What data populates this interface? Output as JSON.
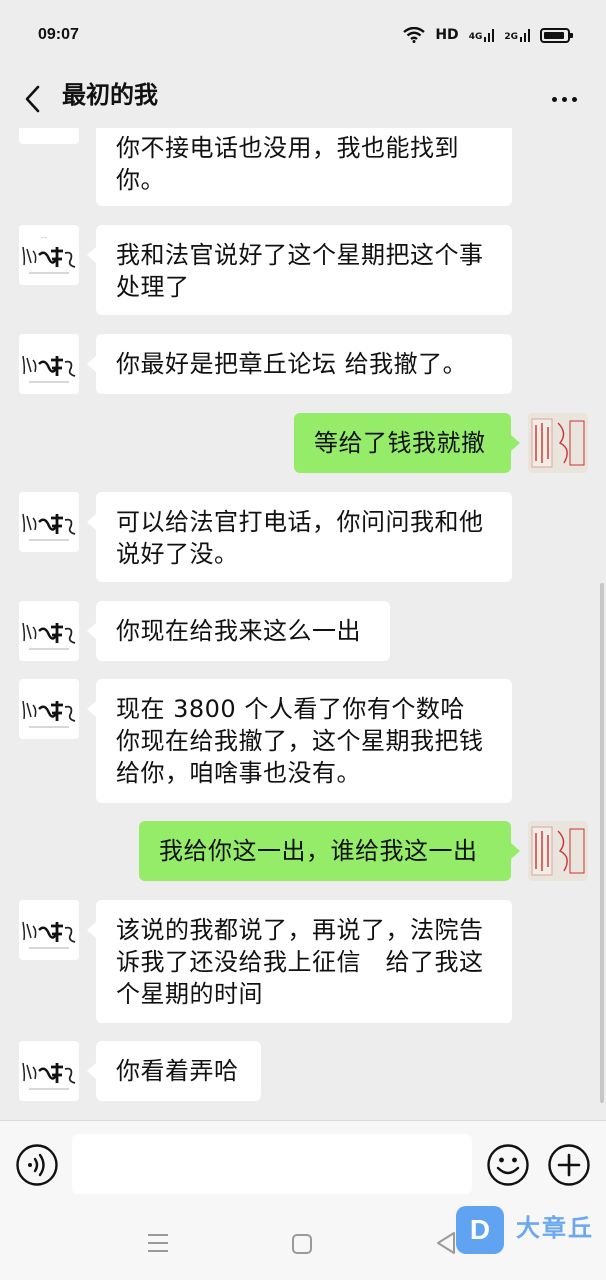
{
  "status_bar": {
    "time": "09:07",
    "hd": "HD",
    "net1": "4G",
    "net2": "2G"
  },
  "header": {
    "title": "最初的我"
  },
  "messages": [
    {
      "side": "left",
      "text": "你不接电话也没用，我也能找到你。"
    },
    {
      "side": "left",
      "text": "我和法官说好了这个星期把这个事处理了"
    },
    {
      "side": "left",
      "text": "你最好是把章丘论坛 给我撤了。"
    },
    {
      "side": "right",
      "text": "等给了钱我就撤"
    },
    {
      "side": "left",
      "text": "可以给法官打电话，你问问我和他说好了没。"
    },
    {
      "side": "left",
      "text": "你现在给我来这么一出"
    },
    {
      "side": "left",
      "text": "现在 3800 个人看了你有个数哈　　你现在给我撤了，这个星期我把钱给你，咱啥事也没有。"
    },
    {
      "side": "right",
      "text": "我给你这一出，谁给我这一出"
    },
    {
      "side": "left",
      "text": "该说的我都说了，再说了，法院告诉我了还没给我上征信　给了我这个星期的时间"
    },
    {
      "side": "left",
      "text": "你看着弄哈"
    }
  ],
  "avatars": {
    "left_icon": "calligraphy-avatar",
    "right_icon": "red-poster-avatar"
  },
  "input": {
    "placeholder": ""
  },
  "watermark": {
    "logo": "D",
    "text": "大章丘"
  },
  "colors": {
    "background": "#ededed",
    "bubble_self": "#95ec69",
    "bubble_other": "#ffffff",
    "watermark": "#3b8ff0"
  }
}
